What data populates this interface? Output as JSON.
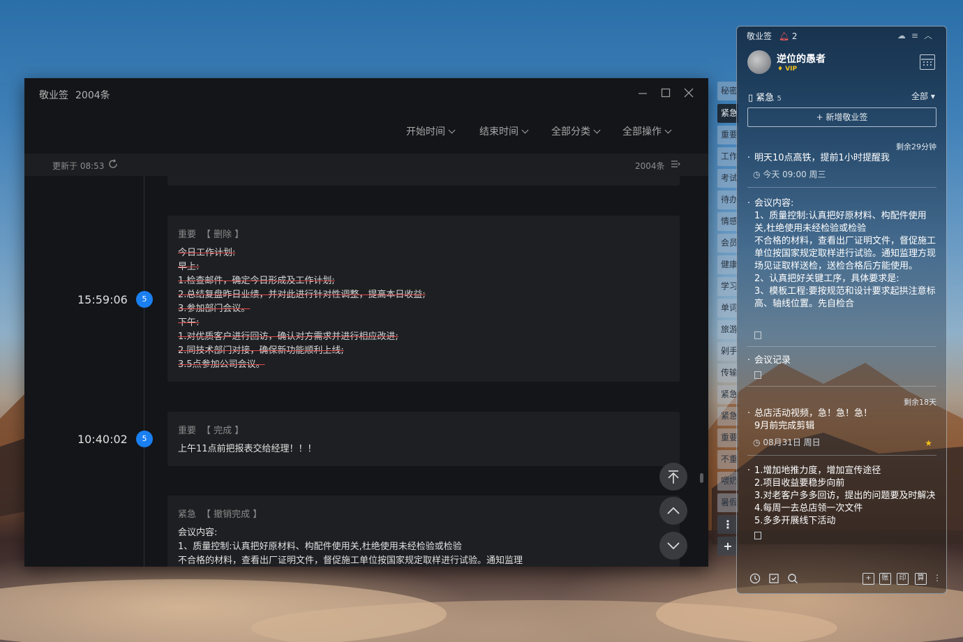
{
  "main_window": {
    "title": "敬业签",
    "count_label": "2004条",
    "filters": [
      "开始时间",
      "结束时间",
      "全部分类",
      "全部操作"
    ],
    "updated": "更新于 08:53",
    "total": "2004条"
  },
  "timeline": [
    {
      "time": "15:59:06",
      "badge": "5",
      "category": "重要",
      "action": "【 删除 】",
      "lines": [
        "今日工作计划:",
        "早上:",
        "1.检查邮件，确定今日形成及工作计划;",
        "2.总结复盘昨日业绩，并对此进行针对性调整，提高本日收益;",
        "3.参加部门会议。",
        "下午:",
        "1.对优质客户进行回访，确认对方需求并进行相应改进;",
        "2.同技术部门对接，确保新功能顺利上线;",
        "3.5点参加公司会议。"
      ]
    },
    {
      "time": "10:40:02",
      "badge": "5",
      "category": "重要",
      "action": "【 完成 】",
      "lines": [
        "上午11点前把报表交给经理！！！"
      ]
    },
    {
      "category": "紧急",
      "action": "【 撤销完成 】",
      "lines": [
        "会议内容:",
        "1、质量控制:认真把好原材料、构配件使用关,杜绝使用未经检验或检验",
        "不合格的材料，查看出厂证明文件，督促施工单位按国家规定取样进行试验。通知监理"
      ]
    }
  ],
  "side_tabs": [
    "秘密",
    "紧急",
    "重要",
    "工作",
    "考试",
    "待办",
    "情感",
    "会员",
    "健康",
    "学习",
    "单词",
    "旅游",
    "剁手",
    "传输",
    "紧急",
    "紧急",
    "重要",
    "不重",
    "喂奶",
    "暑假"
  ],
  "widget": {
    "app_name": "敬业签",
    "reminder_count": "2",
    "username": "逆位的愚者",
    "vip": "VIP",
    "section": "紧急",
    "section_count": "5",
    "filter": "全部",
    "new_button": "+ 新增敬业签",
    "items": [
      {
        "remain": "剩余29分钟",
        "text": [
          "明天10点高铁，提前1小时提醒我"
        ],
        "meta": "今天 09:00 周三"
      },
      {
        "text": [
          "会议内容:",
          "1、质量控制:认真把好原材料、构配件使用关,杜绝使用未经检验或检验",
          "不合格的材料，查看出厂证明文件，督促施工单位按国家规定取样进行试验。通知监理方现场见证取样送检，送检合格后方能使用。",
          "2、认真把好关键工序，具体要求是:",
          "3、模板工程:要按规范和设计要求起拱注意标高、轴线位置。先自检合"
        ]
      },
      {
        "text": [
          "会议记录"
        ]
      },
      {
        "remain": "剩余18天",
        "text": [
          "总店活动视频，急！急！急！",
          "9月前完成剪辑"
        ],
        "meta": "08月31日 周日"
      },
      {
        "text": [
          "1.增加地推力度，增加宣传途径",
          "2.项目收益要稳步向前",
          "3.对老客户多多回访，提出的问题要及时解决",
          "4.每周一去总店领一次文件",
          "5.多多开展线下活动"
        ]
      }
    ],
    "bottom_tools": [
      "账",
      "印",
      "算"
    ]
  }
}
